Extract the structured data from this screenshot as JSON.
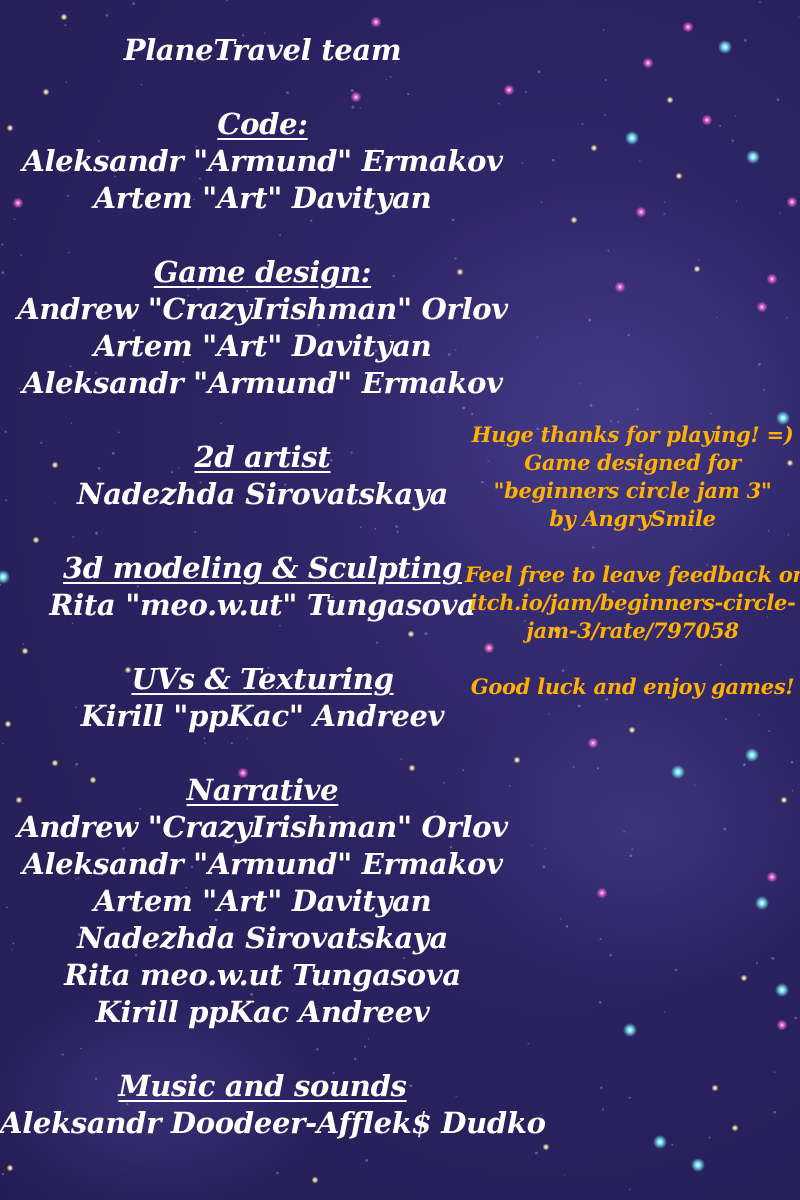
{
  "credits": {
    "team_title": "PlaneTravel team",
    "sections": [
      {
        "heading": "Code:",
        "members": [
          "Aleksandr \"Armund\" Ermakov",
          "Artem \"Art\" Davityan"
        ]
      },
      {
        "heading": "Game design:",
        "members": [
          "Andrew \"CrazyIrishman\" Orlov",
          "Artem \"Art\" Davityan",
          "Aleksandr \"Armund\" Ermakov"
        ]
      },
      {
        "heading": "2d artist",
        "members": [
          "Nadezhda Sirovatskaya"
        ]
      },
      {
        "heading": "3d modeling & Sculpting",
        "members": [
          "Rita \"meo.w.ut\" Tungasova"
        ]
      },
      {
        "heading": "UVs & Texturing",
        "members": [
          "Kirill \"ppKac\" Andreev"
        ]
      },
      {
        "heading": "Narrative",
        "members": [
          "Andrew \"CrazyIrishman\" Orlov",
          "Aleksandr \"Armund\" Ermakov",
          "Artem \"Art\" Davityan",
          "Nadezhda Sirovatskaya",
          "Rita meo.w.ut Tungasova",
          "Kirill ppKac Andreev"
        ]
      },
      {
        "heading": "Music and sounds",
        "members": [
          "Aleksandr Doodeer-Afflek$ Dudko"
        ]
      }
    ]
  },
  "thanks": {
    "line1": "Huge thanks for playing! =)",
    "line2": "Game designed for",
    "line3": "\"beginners circle jam 3\"",
    "line4": "by AngrySmile"
  },
  "feedback": {
    "line1": "Feel free to leave feedback on",
    "line2": "itch.io/jam/beginners-circle-",
    "line3": "jam-3/rate/797058"
  },
  "good_luck": "Good luck and enjoy games!",
  "colors": {
    "background": "#2c2463",
    "credits_text": "#ffffff",
    "message_text": "#ffb000",
    "star_cyan": "#7ef9ff",
    "star_pink": "#ff6ad8",
    "star_yellow": "#fff3a0"
  }
}
